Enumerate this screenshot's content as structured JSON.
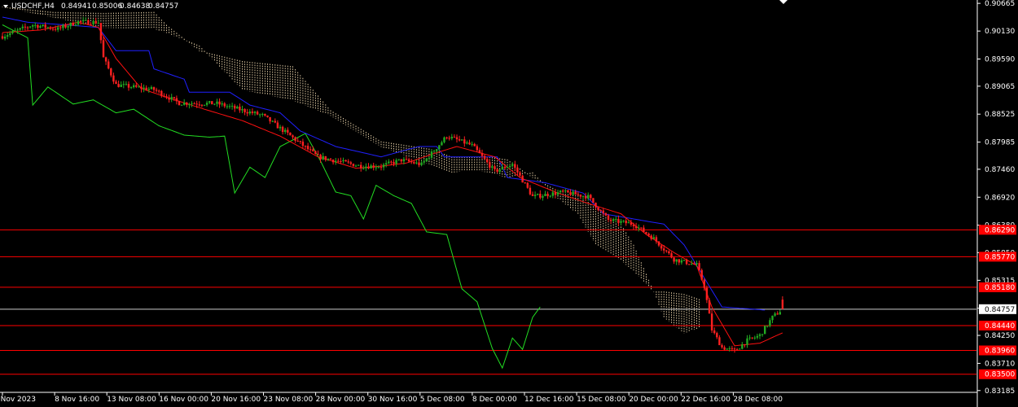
{
  "header": {
    "symbol": "USDCHF,H4",
    "open": "0.84941",
    "high": "0.85006",
    "low": "0.84638",
    "close": "0.84757"
  },
  "chart_data": {
    "type": "candlestick",
    "ylim": [
      0.8315,
      0.9073
    ],
    "price_ticks": [
      "0.90665",
      "0.90130",
      "0.89590",
      "0.89065",
      "0.88525",
      "0.87985",
      "0.87460",
      "0.86920",
      "0.86380",
      "0.85850",
      "0.85315",
      "0.84775",
      "0.84250",
      "0.83710",
      "0.83185"
    ],
    "time_labels": [
      "6 Nov 2023",
      "8 Nov 16:00",
      "13 Nov 08:00",
      "16 Nov 00:00",
      "20 Nov 16:00",
      "23 Nov 08:00",
      "28 Nov 00:00",
      "30 Nov 16:00",
      "5 Dec 08:00",
      "8 Dec 00:00",
      "12 Dec 16:00",
      "15 Dec 08:00",
      "20 Dec 00:00",
      "22 Dec 16:00",
      "28 Dec 08:00"
    ],
    "current_price": "0.84757",
    "levels": [
      {
        "label": "0.86290",
        "value": 0.8629
      },
      {
        "label": "0.85770",
        "value": 0.8577
      },
      {
        "label": "0.85180",
        "value": 0.8518
      },
      {
        "label": "0.84440",
        "value": 0.8444
      },
      {
        "label": "0.83960",
        "value": 0.8396
      },
      {
        "label": "0.83500",
        "value": 0.835
      }
    ],
    "colors": {
      "background": "#000000",
      "bull": "#22aa22",
      "bear": "#ff2020",
      "tenkan": "#ff1010",
      "kijun": "#2020ff",
      "chikou": "#22dd22",
      "cloud": "#f5deb3",
      "level": "#ff0000",
      "current": "#ffffff"
    },
    "close_anchors": [
      [
        0,
        0.9003
      ],
      [
        12,
        0.9025
      ],
      [
        22,
        0.9017
      ],
      [
        30,
        0.9031
      ],
      [
        38,
        0.903
      ],
      [
        40,
        0.8961
      ],
      [
        45,
        0.8909
      ],
      [
        60,
        0.89
      ],
      [
        70,
        0.8874
      ],
      [
        85,
        0.8873
      ],
      [
        95,
        0.886
      ],
      [
        103,
        0.885
      ],
      [
        112,
        0.8818
      ],
      [
        125,
        0.877
      ],
      [
        142,
        0.8752
      ],
      [
        150,
        0.8752
      ],
      [
        158,
        0.8764
      ],
      [
        166,
        0.8755
      ],
      [
        176,
        0.881
      ],
      [
        186,
        0.8792
      ],
      [
        195,
        0.8742
      ],
      [
        202,
        0.8756
      ],
      [
        210,
        0.8693
      ],
      [
        222,
        0.8702
      ],
      [
        232,
        0.8693
      ],
      [
        240,
        0.8648
      ],
      [
        250,
        0.864
      ],
      [
        258,
        0.8612
      ],
      [
        266,
        0.8572
      ],
      [
        275,
        0.8561
      ],
      [
        278,
        0.852
      ],
      [
        281,
        0.8436
      ],
      [
        285,
        0.8402
      ],
      [
        290,
        0.8395
      ],
      [
        295,
        0.8415
      ],
      [
        300,
        0.8425
      ],
      [
        305,
        0.846
      ],
      [
        309,
        0.8476
      ]
    ],
    "tenkan_anchors": [
      [
        0,
        0.901
      ],
      [
        15,
        0.9015
      ],
      [
        30,
        0.903
      ],
      [
        38,
        0.902
      ],
      [
        45,
        0.896
      ],
      [
        55,
        0.8902
      ],
      [
        65,
        0.8885
      ],
      [
        80,
        0.8862
      ],
      [
        95,
        0.884
      ],
      [
        110,
        0.881
      ],
      [
        125,
        0.877
      ],
      [
        140,
        0.8748
      ],
      [
        150,
        0.8752
      ],
      [
        160,
        0.8758
      ],
      [
        170,
        0.8775
      ],
      [
        180,
        0.879
      ],
      [
        195,
        0.877
      ],
      [
        205,
        0.873
      ],
      [
        220,
        0.87
      ],
      [
        232,
        0.868
      ],
      [
        245,
        0.866
      ],
      [
        255,
        0.862
      ],
      [
        266,
        0.8585
      ],
      [
        275,
        0.856
      ],
      [
        281,
        0.848
      ],
      [
        290,
        0.8405
      ],
      [
        300,
        0.841
      ],
      [
        309,
        0.843
      ]
    ],
    "kijun_anchors": [
      [
        0,
        0.904
      ],
      [
        10,
        0.903
      ],
      [
        25,
        0.9025
      ],
      [
        38,
        0.902
      ],
      [
        45,
        0.8975
      ],
      [
        58,
        0.8975
      ],
      [
        60,
        0.894
      ],
      [
        72,
        0.892
      ],
      [
        74,
        0.8895
      ],
      [
        90,
        0.8895
      ],
      [
        98,
        0.887
      ],
      [
        110,
        0.8855
      ],
      [
        118,
        0.882
      ],
      [
        132,
        0.879
      ],
      [
        150,
        0.877
      ],
      [
        165,
        0.879
      ],
      [
        172,
        0.879
      ],
      [
        175,
        0.877
      ],
      [
        196,
        0.877
      ],
      [
        200,
        0.873
      ],
      [
        215,
        0.872
      ],
      [
        230,
        0.87
      ],
      [
        238,
        0.866
      ],
      [
        250,
        0.865
      ],
      [
        262,
        0.864
      ],
      [
        270,
        0.86
      ],
      [
        285,
        0.848
      ],
      [
        302,
        0.8474
      ]
    ],
    "chikou_anchors": [
      [
        0,
        0.9025
      ],
      [
        10,
        0.9
      ],
      [
        12,
        0.887
      ],
      [
        18,
        0.8905
      ],
      [
        28,
        0.8872
      ],
      [
        36,
        0.888
      ],
      [
        45,
        0.8855
      ],
      [
        52,
        0.8862
      ],
      [
        62,
        0.883
      ],
      [
        72,
        0.8812
      ],
      [
        82,
        0.8808
      ],
      [
        88,
        0.881
      ],
      [
        92,
        0.87
      ],
      [
        98,
        0.875
      ],
      [
        104,
        0.873
      ],
      [
        110,
        0.879
      ],
      [
        120,
        0.8815
      ],
      [
        126,
        0.8762
      ],
      [
        132,
        0.8702
      ],
      [
        138,
        0.8695
      ],
      [
        143,
        0.865
      ],
      [
        148,
        0.8715
      ],
      [
        155,
        0.8695
      ],
      [
        162,
        0.868
      ],
      [
        168,
        0.8625
      ],
      [
        176,
        0.862
      ],
      [
        182,
        0.8515
      ],
      [
        188,
        0.849
      ],
      [
        194,
        0.84
      ],
      [
        198,
        0.8362
      ],
      [
        202,
        0.842
      ],
      [
        206,
        0.8398
      ],
      [
        210,
        0.846
      ],
      [
        213,
        0.848
      ]
    ],
    "cloud_anchors": [
      [
        0,
        0.906,
        0.906
      ],
      [
        20,
        0.905,
        0.904
      ],
      [
        40,
        0.9048,
        0.902
      ],
      [
        60,
        0.905,
        0.9018
      ],
      [
        65,
        0.9025,
        0.901
      ],
      [
        78,
        0.8975,
        0.8985
      ],
      [
        95,
        0.8955,
        0.89
      ],
      [
        115,
        0.8945,
        0.888
      ],
      [
        130,
        0.886,
        0.885
      ],
      [
        150,
        0.88,
        0.879
      ],
      [
        170,
        0.8785,
        0.8755
      ],
      [
        178,
        0.877,
        0.874
      ],
      [
        186,
        0.877,
        0.8745
      ],
      [
        193,
        0.877,
        0.874
      ],
      [
        200,
        0.8765,
        0.873
      ],
      [
        210,
        0.873,
        0.874
      ],
      [
        220,
        0.8705,
        0.869
      ],
      [
        228,
        0.87,
        0.866
      ],
      [
        235,
        0.867,
        0.86
      ],
      [
        245,
        0.864,
        0.857
      ],
      [
        250,
        0.86,
        0.855
      ],
      [
        258,
        0.851,
        0.851
      ],
      [
        262,
        0.851,
        0.846
      ],
      [
        270,
        0.8505,
        0.843
      ],
      [
        276,
        0.8495,
        0.844
      ]
    ]
  }
}
